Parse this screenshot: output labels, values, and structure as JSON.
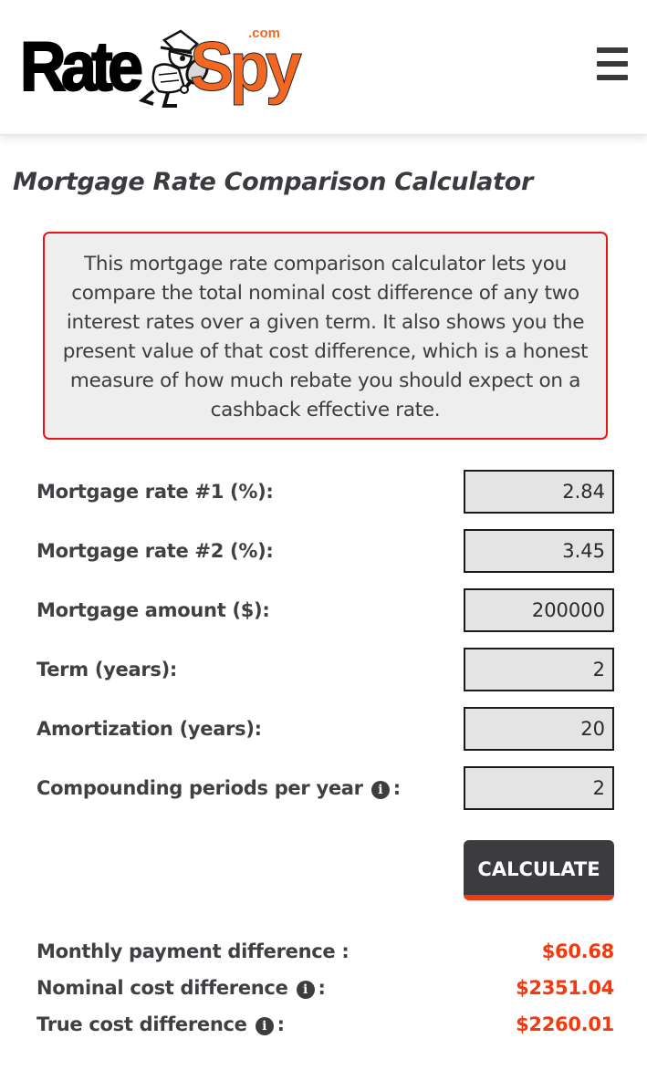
{
  "header": {
    "logo": {
      "text_left": "Rate",
      "text_right": "Spy",
      "suffix": ".com",
      "alt": "RateSpy.com"
    },
    "menu_icon": "hamburger-menu-icon"
  },
  "page": {
    "title": "Mortgage Rate Comparison Calculator",
    "description": "This mortgage rate comparison calculator lets you compare the total nominal cost difference of any two interest rates over a given term. It also shows you the present value of that cost difference, which is a honest measure of how much rebate you should expect on a cashback effective rate."
  },
  "form": {
    "fields": [
      {
        "label": "Mortgage rate #1 (%):",
        "value": "2.84",
        "has_info": false
      },
      {
        "label": "Mortgage rate #2 (%):",
        "value": "3.45",
        "has_info": false
      },
      {
        "label": "Mortgage amount ($):",
        "value": "200000",
        "has_info": false
      },
      {
        "label": "Term (years):",
        "value": "2",
        "has_info": false
      },
      {
        "label": "Amortization (years):",
        "value": "20",
        "has_info": false
      },
      {
        "label": "Compounding periods per year",
        "label_suffix": ":",
        "value": "2",
        "has_info": true
      }
    ],
    "calculate_label": "CALCULATE"
  },
  "results": [
    {
      "label": "Monthly payment difference",
      "label_suffix": ":",
      "value": "$60.68",
      "has_info": false
    },
    {
      "label": "Nominal cost difference",
      "label_suffix": ":",
      "value": "$2351.04",
      "has_info": true
    },
    {
      "label": "True cost difference",
      "label_suffix": ":",
      "value": "$2260.01",
      "has_info": true
    }
  ],
  "icons": {
    "info": "i"
  },
  "colors": {
    "accent": "#f23a0f",
    "logo_orange": "#f26722",
    "info_border": "#e81515",
    "button_bg": "#3b3b40",
    "text": "#3f3f44"
  }
}
